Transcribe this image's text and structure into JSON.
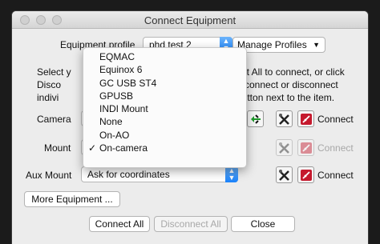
{
  "window": {
    "title": "Connect Equipment"
  },
  "profile": {
    "label": "Equipment profile",
    "value": "phd test 2",
    "manage_label": "Manage Profiles"
  },
  "instructions": {
    "left": [
      "Select y",
      "Disco",
      "indivi"
    ],
    "right": [
      "ect All to connect, or click",
      "o connect or disconnect",
      "button next to the item."
    ]
  },
  "rows": [
    {
      "label": "Camera",
      "status": "Connect",
      "enabled": true
    },
    {
      "label": "Mount",
      "status": "Connect",
      "enabled": false
    },
    {
      "label": "Aux Mount",
      "value": "Ask for coordinates",
      "status": "Connect",
      "enabled": true
    }
  ],
  "menu": {
    "items": [
      "EQMAC",
      "Equinox 6",
      "GC USB ST4",
      "GPUSB",
      "INDI Mount",
      "None",
      "On-AO",
      "On-camera"
    ],
    "checked_item": "On-camera"
  },
  "buttons": {
    "more_equipment": "More Equipment ...",
    "connect_all": "Connect All",
    "disconnect_all": "Disconnect All",
    "close": "Close"
  },
  "colors": {
    "accent": "#1a82fb",
    "connect_icon": "#c5192d",
    "disabled_text": "#a8a8a8"
  }
}
